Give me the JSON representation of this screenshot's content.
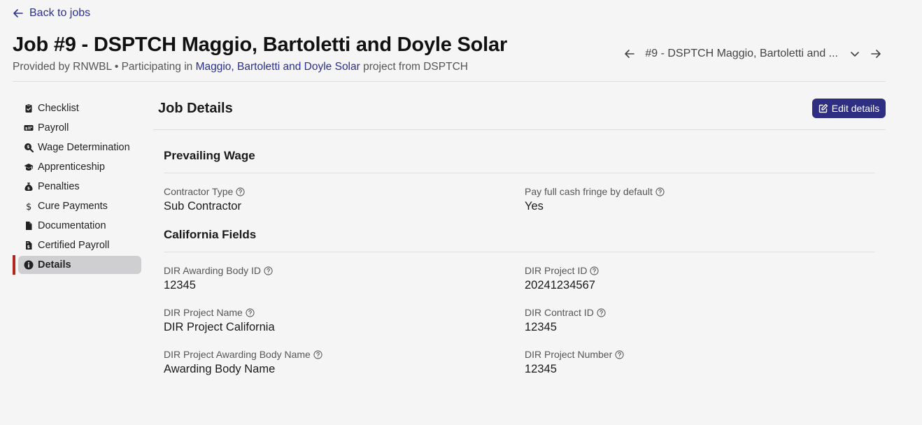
{
  "back_link": "Back to jobs",
  "header": {
    "title": "Job #9 - DSPTCH Maggio, Bartoletti and Doyle Solar",
    "subtitle_prefix": "Provided by RNWBL • Participating in ",
    "subtitle_link": "Maggio, Bartoletti and Doyle Solar",
    "subtitle_suffix": " project from DSPTCH"
  },
  "job_selector": {
    "selected": "#9 - DSPTCH Maggio, Bartoletti and ..."
  },
  "sidebar": {
    "items": [
      {
        "label": "Checklist",
        "icon": "clipboard-check-icon"
      },
      {
        "label": "Payroll",
        "icon": "money-check-icon"
      },
      {
        "label": "Wage Determination",
        "icon": "search-dollar-icon"
      },
      {
        "label": "Apprenticeship",
        "icon": "graduation-cap-icon"
      },
      {
        "label": "Penalties",
        "icon": "money-bag-icon"
      },
      {
        "label": "Cure Payments",
        "icon": "dollar-icon"
      },
      {
        "label": "Documentation",
        "icon": "file-icon"
      },
      {
        "label": "Certified Payroll",
        "icon": "file-invoice-icon"
      },
      {
        "label": "Details",
        "icon": "info-circle-icon",
        "active": true
      }
    ]
  },
  "main": {
    "title": "Job Details",
    "edit_button": "Edit details",
    "groups": [
      {
        "title": "Prevailing Wage",
        "fields": [
          {
            "label": "Contractor Type",
            "value": "Sub Contractor"
          },
          {
            "label": "Pay full cash fringe by default",
            "value": "Yes"
          }
        ]
      },
      {
        "title": "California Fields",
        "fields": [
          {
            "label": "DIR Awarding Body ID",
            "value": "12345"
          },
          {
            "label": "DIR Project ID",
            "value": "20241234567"
          },
          {
            "label": "DIR Project Name",
            "value": "DIR Project California"
          },
          {
            "label": "DIR Contract ID",
            "value": "12345"
          },
          {
            "label": "DIR Project Awarding Body Name",
            "value": "Awarding Body Name"
          },
          {
            "label": "DIR Project Number",
            "value": "12345"
          }
        ]
      }
    ]
  },
  "colors": {
    "accent": "#2e2f82",
    "link": "#2b2f8f",
    "active_marker": "#b3261e",
    "active_pill": "#cfcfd1"
  }
}
